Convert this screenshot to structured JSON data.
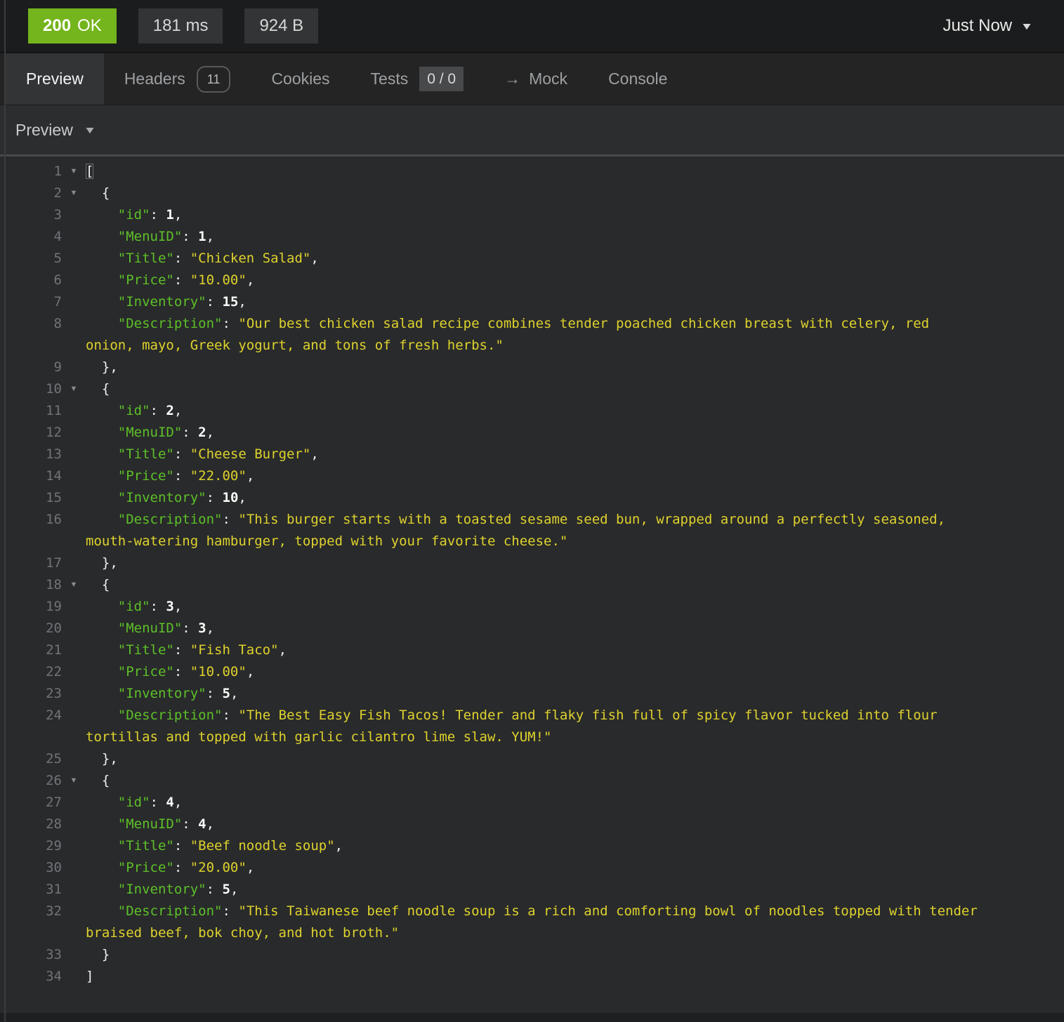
{
  "colors": {
    "status_green": "#74b41c",
    "key_green": "#5dc029",
    "string_yellow": "#ded22e"
  },
  "topbar": {
    "status_code": "200",
    "status_text": "OK",
    "time": "181 ms",
    "size": "924 B",
    "history_label": "Just Now",
    "caret_icon": "▼"
  },
  "tabs": {
    "preview": "Preview",
    "headers": "Headers",
    "headers_count": "11",
    "cookies": "Cookies",
    "tests": "Tests",
    "tests_count": "0 / 0",
    "mock_arrow": "→",
    "mock": "Mock",
    "console": "Console"
  },
  "preview_bar": {
    "label": "Preview",
    "caret_icon": "▼"
  },
  "code": {
    "fold_icon": "▼",
    "rows": [
      {
        "n": "1",
        "fold": true,
        "segs": [
          [
            "b",
            "["
          ]
        ]
      },
      {
        "n": "2",
        "fold": true,
        "segs": [
          [
            "p",
            "  {"
          ]
        ]
      },
      {
        "n": "3",
        "segs": [
          [
            "p",
            "    "
          ],
          [
            "k",
            "\"id\""
          ],
          [
            "p",
            ": "
          ],
          [
            "n",
            "1"
          ],
          [
            "p",
            ","
          ]
        ]
      },
      {
        "n": "4",
        "segs": [
          [
            "p",
            "    "
          ],
          [
            "k",
            "\"MenuID\""
          ],
          [
            "p",
            ": "
          ],
          [
            "n",
            "1"
          ],
          [
            "p",
            ","
          ]
        ]
      },
      {
        "n": "5",
        "segs": [
          [
            "p",
            "    "
          ],
          [
            "k",
            "\"Title\""
          ],
          [
            "p",
            ": "
          ],
          [
            "s",
            "\"Chicken Salad\""
          ],
          [
            "p",
            ","
          ]
        ]
      },
      {
        "n": "6",
        "segs": [
          [
            "p",
            "    "
          ],
          [
            "k",
            "\"Price\""
          ],
          [
            "p",
            ": "
          ],
          [
            "s",
            "\"10.00\""
          ],
          [
            "p",
            ","
          ]
        ]
      },
      {
        "n": "7",
        "segs": [
          [
            "p",
            "    "
          ],
          [
            "k",
            "\"Inventory\""
          ],
          [
            "p",
            ": "
          ],
          [
            "n",
            "15"
          ],
          [
            "p",
            ","
          ]
        ]
      },
      {
        "n": "8",
        "segs": [
          [
            "p",
            "    "
          ],
          [
            "k",
            "\"Description\""
          ],
          [
            "p",
            ": "
          ],
          [
            "s",
            "\"Our best chicken salad recipe combines tender poached chicken breast with celery, red"
          ]
        ]
      },
      {
        "n": "",
        "segs": [
          [
            "s",
            "onion, mayo, Greek yogurt, and tons of fresh herbs.\""
          ]
        ]
      },
      {
        "n": "9",
        "segs": [
          [
            "p",
            "  },"
          ]
        ]
      },
      {
        "n": "10",
        "fold": true,
        "segs": [
          [
            "p",
            "  {"
          ]
        ]
      },
      {
        "n": "11",
        "segs": [
          [
            "p",
            "    "
          ],
          [
            "k",
            "\"id\""
          ],
          [
            "p",
            ": "
          ],
          [
            "n",
            "2"
          ],
          [
            "p",
            ","
          ]
        ]
      },
      {
        "n": "12",
        "segs": [
          [
            "p",
            "    "
          ],
          [
            "k",
            "\"MenuID\""
          ],
          [
            "p",
            ": "
          ],
          [
            "n",
            "2"
          ],
          [
            "p",
            ","
          ]
        ]
      },
      {
        "n": "13",
        "segs": [
          [
            "p",
            "    "
          ],
          [
            "k",
            "\"Title\""
          ],
          [
            "p",
            ": "
          ],
          [
            "s",
            "\"Cheese Burger\""
          ],
          [
            "p",
            ","
          ]
        ]
      },
      {
        "n": "14",
        "segs": [
          [
            "p",
            "    "
          ],
          [
            "k",
            "\"Price\""
          ],
          [
            "p",
            ": "
          ],
          [
            "s",
            "\"22.00\""
          ],
          [
            "p",
            ","
          ]
        ]
      },
      {
        "n": "15",
        "segs": [
          [
            "p",
            "    "
          ],
          [
            "k",
            "\"Inventory\""
          ],
          [
            "p",
            ": "
          ],
          [
            "n",
            "10"
          ],
          [
            "p",
            ","
          ]
        ]
      },
      {
        "n": "16",
        "segs": [
          [
            "p",
            "    "
          ],
          [
            "k",
            "\"Description\""
          ],
          [
            "p",
            ": "
          ],
          [
            "s",
            "\"This burger starts with a toasted sesame seed bun, wrapped around a perfectly seasoned,"
          ]
        ]
      },
      {
        "n": "",
        "segs": [
          [
            "s",
            "mouth-watering hamburger, topped with your favorite cheese.\""
          ]
        ]
      },
      {
        "n": "17",
        "segs": [
          [
            "p",
            "  },"
          ]
        ]
      },
      {
        "n": "18",
        "fold": true,
        "segs": [
          [
            "p",
            "  {"
          ]
        ]
      },
      {
        "n": "19",
        "segs": [
          [
            "p",
            "    "
          ],
          [
            "k",
            "\"id\""
          ],
          [
            "p",
            ": "
          ],
          [
            "n",
            "3"
          ],
          [
            "p",
            ","
          ]
        ]
      },
      {
        "n": "20",
        "segs": [
          [
            "p",
            "    "
          ],
          [
            "k",
            "\"MenuID\""
          ],
          [
            "p",
            ": "
          ],
          [
            "n",
            "3"
          ],
          [
            "p",
            ","
          ]
        ]
      },
      {
        "n": "21",
        "segs": [
          [
            "p",
            "    "
          ],
          [
            "k",
            "\"Title\""
          ],
          [
            "p",
            ": "
          ],
          [
            "s",
            "\"Fish Taco\""
          ],
          [
            "p",
            ","
          ]
        ]
      },
      {
        "n": "22",
        "segs": [
          [
            "p",
            "    "
          ],
          [
            "k",
            "\"Price\""
          ],
          [
            "p",
            ": "
          ],
          [
            "s",
            "\"10.00\""
          ],
          [
            "p",
            ","
          ]
        ]
      },
      {
        "n": "23",
        "segs": [
          [
            "p",
            "    "
          ],
          [
            "k",
            "\"Inventory\""
          ],
          [
            "p",
            ": "
          ],
          [
            "n",
            "5"
          ],
          [
            "p",
            ","
          ]
        ]
      },
      {
        "n": "24",
        "segs": [
          [
            "p",
            "    "
          ],
          [
            "k",
            "\"Description\""
          ],
          [
            "p",
            ": "
          ],
          [
            "s",
            "\"The Best Easy Fish Tacos! Tender and flaky fish full of spicy flavor tucked into flour"
          ]
        ]
      },
      {
        "n": "",
        "segs": [
          [
            "s",
            "tortillas and topped with garlic cilantro lime slaw. YUM!\""
          ]
        ]
      },
      {
        "n": "25",
        "segs": [
          [
            "p",
            "  },"
          ]
        ]
      },
      {
        "n": "26",
        "fold": true,
        "segs": [
          [
            "p",
            "  {"
          ]
        ]
      },
      {
        "n": "27",
        "segs": [
          [
            "p",
            "    "
          ],
          [
            "k",
            "\"id\""
          ],
          [
            "p",
            ": "
          ],
          [
            "n",
            "4"
          ],
          [
            "p",
            ","
          ]
        ]
      },
      {
        "n": "28",
        "segs": [
          [
            "p",
            "    "
          ],
          [
            "k",
            "\"MenuID\""
          ],
          [
            "p",
            ": "
          ],
          [
            "n",
            "4"
          ],
          [
            "p",
            ","
          ]
        ]
      },
      {
        "n": "29",
        "segs": [
          [
            "p",
            "    "
          ],
          [
            "k",
            "\"Title\""
          ],
          [
            "p",
            ": "
          ],
          [
            "s",
            "\"Beef noodle soup\""
          ],
          [
            "p",
            ","
          ]
        ]
      },
      {
        "n": "30",
        "segs": [
          [
            "p",
            "    "
          ],
          [
            "k",
            "\"Price\""
          ],
          [
            "p",
            ": "
          ],
          [
            "s",
            "\"20.00\""
          ],
          [
            "p",
            ","
          ]
        ]
      },
      {
        "n": "31",
        "segs": [
          [
            "p",
            "    "
          ],
          [
            "k",
            "\"Inventory\""
          ],
          [
            "p",
            ": "
          ],
          [
            "n",
            "5"
          ],
          [
            "p",
            ","
          ]
        ]
      },
      {
        "n": "32",
        "segs": [
          [
            "p",
            "    "
          ],
          [
            "k",
            "\"Description\""
          ],
          [
            "p",
            ": "
          ],
          [
            "s",
            "\"This Taiwanese beef noodle soup is a rich and comforting bowl of noodles topped with tender"
          ]
        ]
      },
      {
        "n": "",
        "segs": [
          [
            "s",
            "braised beef, bok choy, and hot broth.\""
          ]
        ]
      },
      {
        "n": "33",
        "segs": [
          [
            "p",
            "  }"
          ]
        ]
      },
      {
        "n": "34",
        "segs": [
          [
            "p",
            "]"
          ]
        ]
      }
    ]
  }
}
